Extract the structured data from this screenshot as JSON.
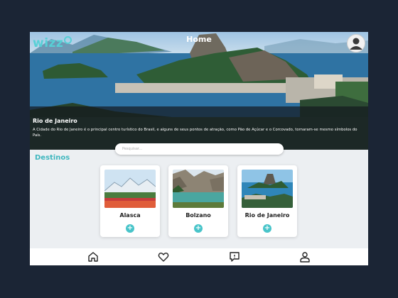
{
  "header": {
    "logo": "wizz",
    "title": "Home",
    "avatar_icon": "user-avatar-icon"
  },
  "hero": {
    "city": "Rio de Janeiro",
    "description": "A Cidade do Rio de Janeiro é o principal centro turístico do Brasil, e alguns de seus pontos de atração, como Pão de Açúcar e o Corcovado, tornaram-se mesmo símbolos do País."
  },
  "search": {
    "placeholder": "Pesquisar..."
  },
  "destinations": {
    "title": "Destinos",
    "items": [
      {
        "name": "Alasca",
        "add_label": "+"
      },
      {
        "name": "Bolzano",
        "add_label": "+"
      },
      {
        "name": "Rio de Janeiro",
        "add_label": "+"
      }
    ]
  },
  "nav": {
    "items": [
      {
        "icon": "home-icon"
      },
      {
        "icon": "heart-icon"
      },
      {
        "icon": "chat-icon"
      },
      {
        "icon": "profile-icon"
      }
    ]
  },
  "colors": {
    "accent": "#48c4c9",
    "background": "#1b2535"
  }
}
